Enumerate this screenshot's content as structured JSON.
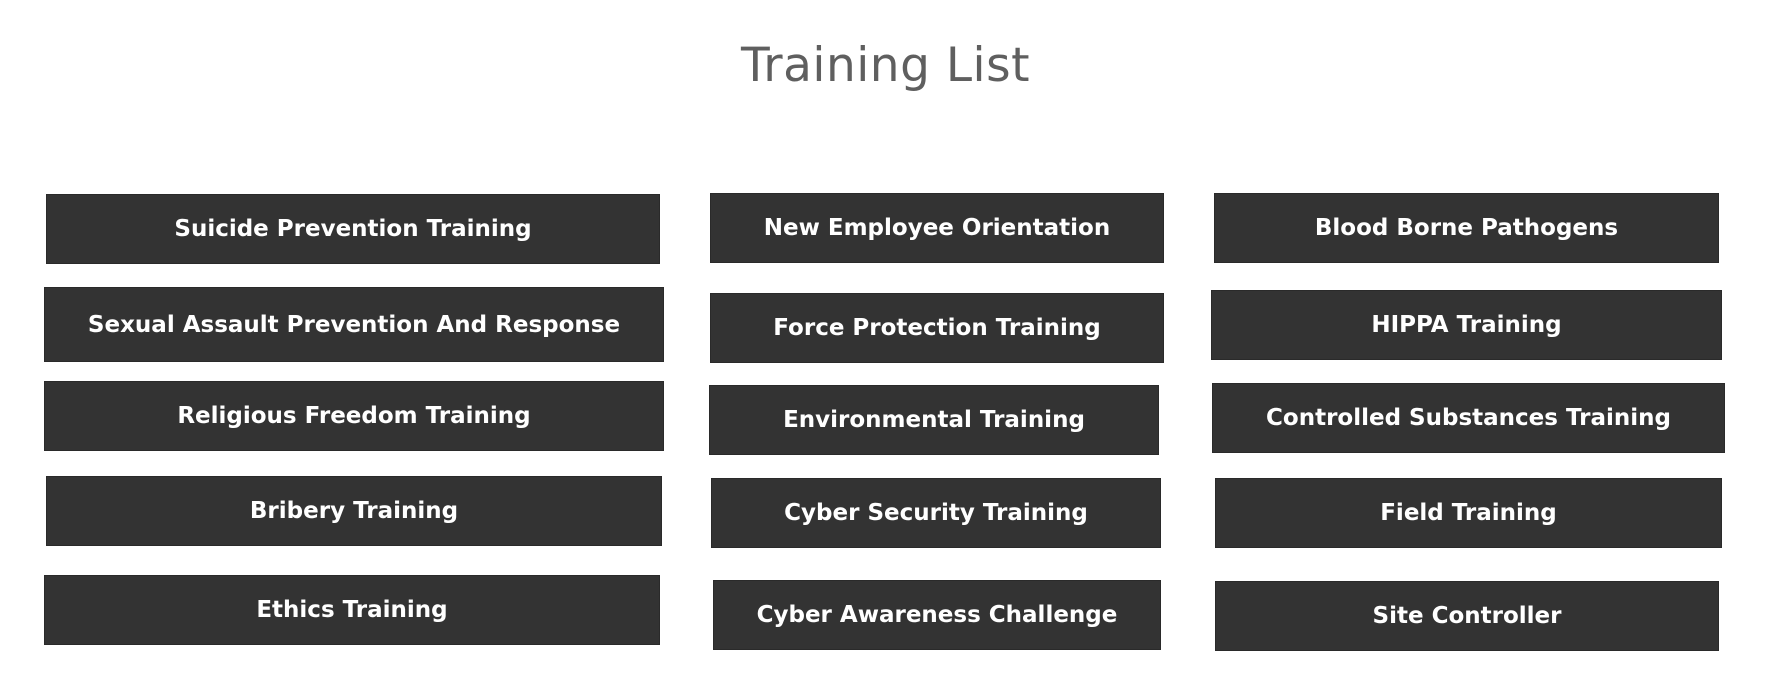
{
  "page": {
    "title": "Training List",
    "colors": {
      "background": "#ffffff",
      "title_text": "#5f5f5f",
      "button_background": "#333333",
      "button_text": "#ffffff"
    }
  },
  "trainings": {
    "column_1": [
      "Suicide Prevention Training",
      "Sexual Assault Prevention And Response",
      "Religious Freedom Training",
      "Bribery Training",
      "Ethics Training"
    ],
    "column_2": [
      "New Employee Orientation",
      "Force Protection Training",
      "Environmental Training",
      "Cyber Security Training",
      "Cyber Awareness Challenge"
    ],
    "column_3": [
      "Blood Borne Pathogens",
      "HIPPA Training",
      "Controlled Substances Training",
      "Field Training",
      "Site Controller"
    ]
  }
}
